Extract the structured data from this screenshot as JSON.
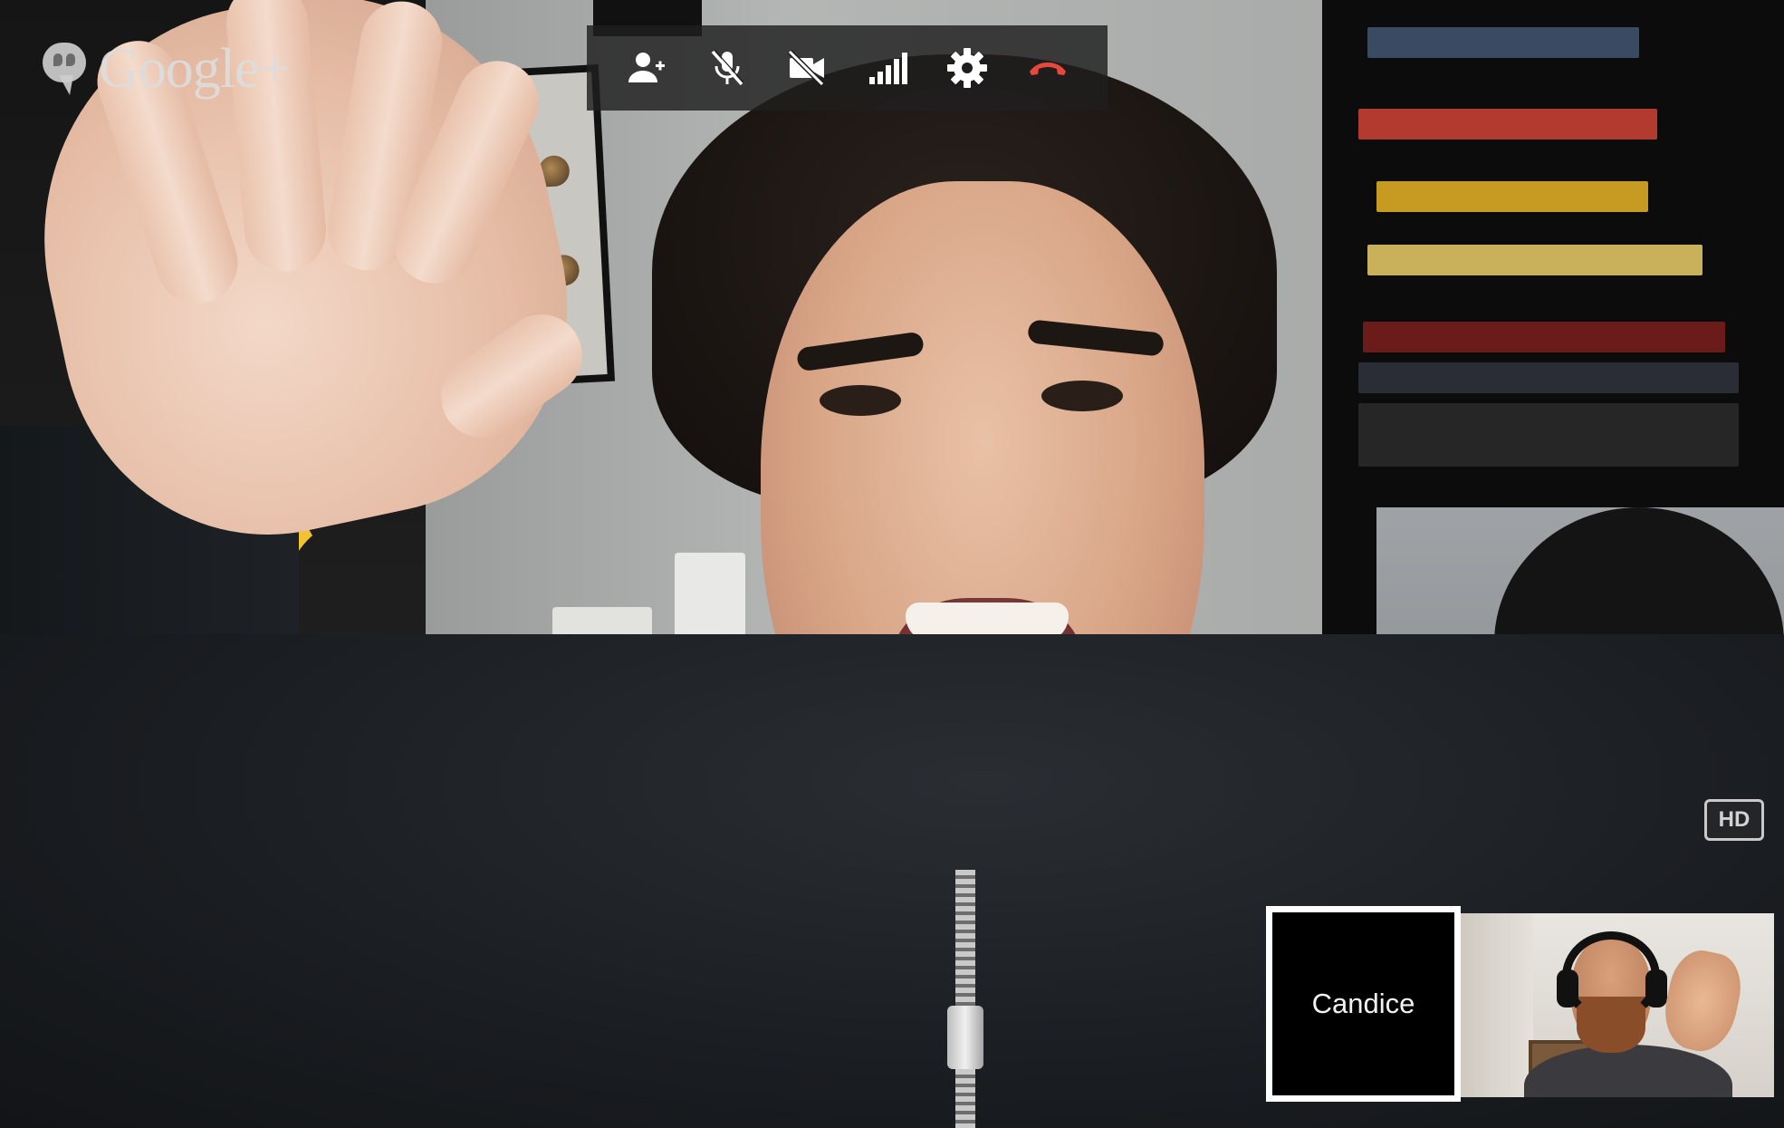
{
  "app": {
    "brand_text": "Google+",
    "brand_icon": "hangouts-icon"
  },
  "toolbar": {
    "buttons": [
      {
        "name": "invite-people",
        "icon": "add-person-icon",
        "color": "#ffffff"
      },
      {
        "name": "mute-microphone",
        "icon": "mic-off-icon",
        "color": "#ffffff"
      },
      {
        "name": "turn-off-camera",
        "icon": "camera-off-icon",
        "color": "#ffffff"
      },
      {
        "name": "bandwidth",
        "icon": "signal-bars-icon",
        "color": "#ffffff"
      },
      {
        "name": "settings",
        "icon": "gear-icon",
        "color": "#ffffff"
      },
      {
        "name": "hang-up",
        "icon": "hang-up-icon",
        "color": "#e8473a"
      }
    ]
  },
  "video": {
    "hd_label": "HD"
  },
  "participants": [
    {
      "name": "Candice",
      "video_on": false,
      "selected": true
    },
    {
      "name": "",
      "video_on": true,
      "selected": false
    }
  ],
  "colors": {
    "toolbar_bg": "rgba(30,30,30,0.82)",
    "hang_up": "#e8473a",
    "selected_border": "#ffffff",
    "tile_bg": "#000000"
  }
}
